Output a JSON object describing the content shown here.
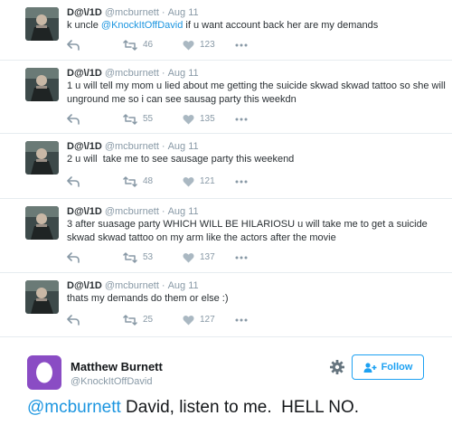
{
  "tweets": [
    {
      "name": "D@\\/1D",
      "handle": "@mcburnett",
      "separator": "·",
      "date": "Aug 11",
      "text_before": "k uncle ",
      "mention": "@KnockItOffDavid",
      "text_after": " if u want account back her are my demands",
      "retweets": "46",
      "likes": "123"
    },
    {
      "name": "D@\\/1D",
      "handle": "@mcburnett",
      "separator": "·",
      "date": "Aug 11",
      "text_before": "1 u will tell my mom u lied about me getting the suicide skwad skwad tattoo so she will unground me so i can see sausag party this weekdn",
      "mention": "",
      "text_after": "",
      "retweets": "55",
      "likes": "135"
    },
    {
      "name": "D@\\/1D",
      "handle": "@mcburnett",
      "separator": "·",
      "date": "Aug 11",
      "text_before": "2 u will  take me to see sausage party this weekend",
      "mention": "",
      "text_after": "",
      "retweets": "48",
      "likes": "121"
    },
    {
      "name": "D@\\/1D",
      "handle": "@mcburnett",
      "separator": "·",
      "date": "Aug 11",
      "text_before": "3 after suasage party WHICH WILL BE HILARIOSU u will take me to get a suicide skwad skwad tattoo on my arm like the actors after the movie",
      "mention": "",
      "text_after": "",
      "retweets": "53",
      "likes": "137"
    },
    {
      "name": "D@\\/1D",
      "handle": "@mcburnett",
      "separator": "·",
      "date": "Aug 11",
      "text_before": "thats my demands do them or else :)",
      "mention": "",
      "text_after": "",
      "retweets": "25",
      "likes": "127"
    }
  ],
  "icons": {
    "reply": "reply-icon",
    "retweet": "retweet-icon",
    "like": "heart-icon",
    "more": "more-dots-icon",
    "settings": "gear-icon",
    "follow": "add-user-icon"
  },
  "reply_card": {
    "name": "Matthew Burnett",
    "handle": "@KnockItOffDavid",
    "follow_label": "Follow",
    "mention": "@mcburnett",
    "text": " David, listen to me.  HELL NO.",
    "avatar_color": "#8a4cc4"
  },
  "colors": {
    "link": "#1b95e0",
    "muted": "#8899a6",
    "follow": "#1da1f2"
  }
}
